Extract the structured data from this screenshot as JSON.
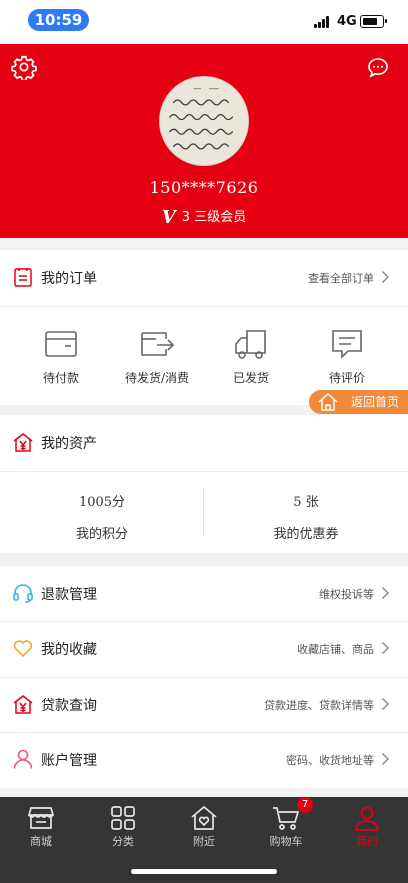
{
  "status": {
    "time": "10:59",
    "network": "4G"
  },
  "profile": {
    "phone": "150****7626",
    "level_num": "3",
    "level_text": "三级会员"
  },
  "orders": {
    "title": "我的订单",
    "view_all": "查看全部订单",
    "items": [
      {
        "label": "待付款",
        "icon": "wallet-icon"
      },
      {
        "label": "待发货/消费",
        "icon": "shipping-box-icon"
      },
      {
        "label": "已发货",
        "icon": "truck-icon"
      },
      {
        "label": "待评价",
        "icon": "comment-icon"
      }
    ]
  },
  "back_home": "返回首页",
  "assets": {
    "title": "我的资产",
    "points_value": "1005分",
    "points_label": "我的积分",
    "coupons_value": "5 张",
    "coupons_label": "我的优惠券"
  },
  "menu": [
    {
      "title": "退款管理",
      "hint": "维权投诉等",
      "icon": "headset-icon"
    },
    {
      "title": "我的收藏",
      "hint": "收藏店铺、商品",
      "icon": "heart-icon"
    },
    {
      "title": "贷款查询",
      "hint": "贷款进度、贷款详情等",
      "icon": "loan-icon"
    },
    {
      "title": "账户管理",
      "hint": "密码、收货地址等",
      "icon": "user-icon"
    }
  ],
  "tabs": [
    {
      "label": "商城",
      "icon": "store-icon"
    },
    {
      "label": "分类",
      "icon": "grid-icon"
    },
    {
      "label": "附近",
      "icon": "nearby-icon"
    },
    {
      "label": "购物车",
      "icon": "cart-icon"
    },
    {
      "label": "我的",
      "icon": "profile-icon"
    }
  ],
  "cart_badge": "7",
  "colors": {
    "brand_red": "#e50012",
    "accent_orange": "#f08a3c",
    "tabbar": "#353535",
    "status_blue": "#2f7bf5"
  }
}
